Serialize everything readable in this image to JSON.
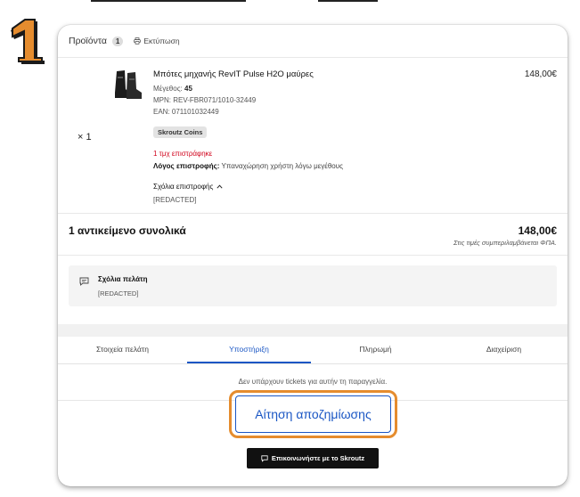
{
  "step": {
    "number": "1",
    "color": "#e58c2e"
  },
  "header": {
    "title": "Προϊόντα",
    "count": "1",
    "print_label": "Εκτύπωση"
  },
  "product": {
    "quantity": "× 1",
    "name": "Μπότες μηχανής RevIT Pulse H2O μαύρες",
    "price": "148,00€",
    "size_label": "Μέγεθος:",
    "size_value": "45",
    "mpn": "MPN: REV-FBR071/1010-32449",
    "ean": "EAN: 071101032449",
    "coins_badge": "Skroutz Coins",
    "returned": "1 τμχ επιστράφηκε",
    "return_reason_label": "Λόγος επιστροφής:",
    "return_reason_value": "Υπαναχώρηση χρήστη λόγω μεγέθους",
    "return_comments_label": "Σχόλια επιστροφής",
    "return_comments_value": "[REDACTED]"
  },
  "totals": {
    "label": "1 αντικείμενο συνολικά",
    "price": "148,00€",
    "vat_note": "Στις τιμές συμπεριλαμβάνεται ΦΠΑ."
  },
  "customer_comments": {
    "title": "Σχόλια πελάτη",
    "value": "[REDACTED]"
  },
  "tabs": [
    {
      "label": "Στοιχεία πελάτη",
      "active": false
    },
    {
      "label": "Υποστήριξη",
      "active": true
    },
    {
      "label": "Πληρωμή",
      "active": false
    },
    {
      "label": "Διαχείριση",
      "active": false
    }
  ],
  "support": {
    "no_tickets": "Δεν υπάρχουν tickets για αυτήν τη παραγγελία.",
    "refund_button": "Αίτηση αποζημίωσης",
    "contact_button": "Επικοινωνήστε με το Skroutz"
  },
  "colors": {
    "accent_blue": "#1a56c4",
    "highlight_orange": "#e58c2e",
    "error_red": "#d0021b"
  }
}
